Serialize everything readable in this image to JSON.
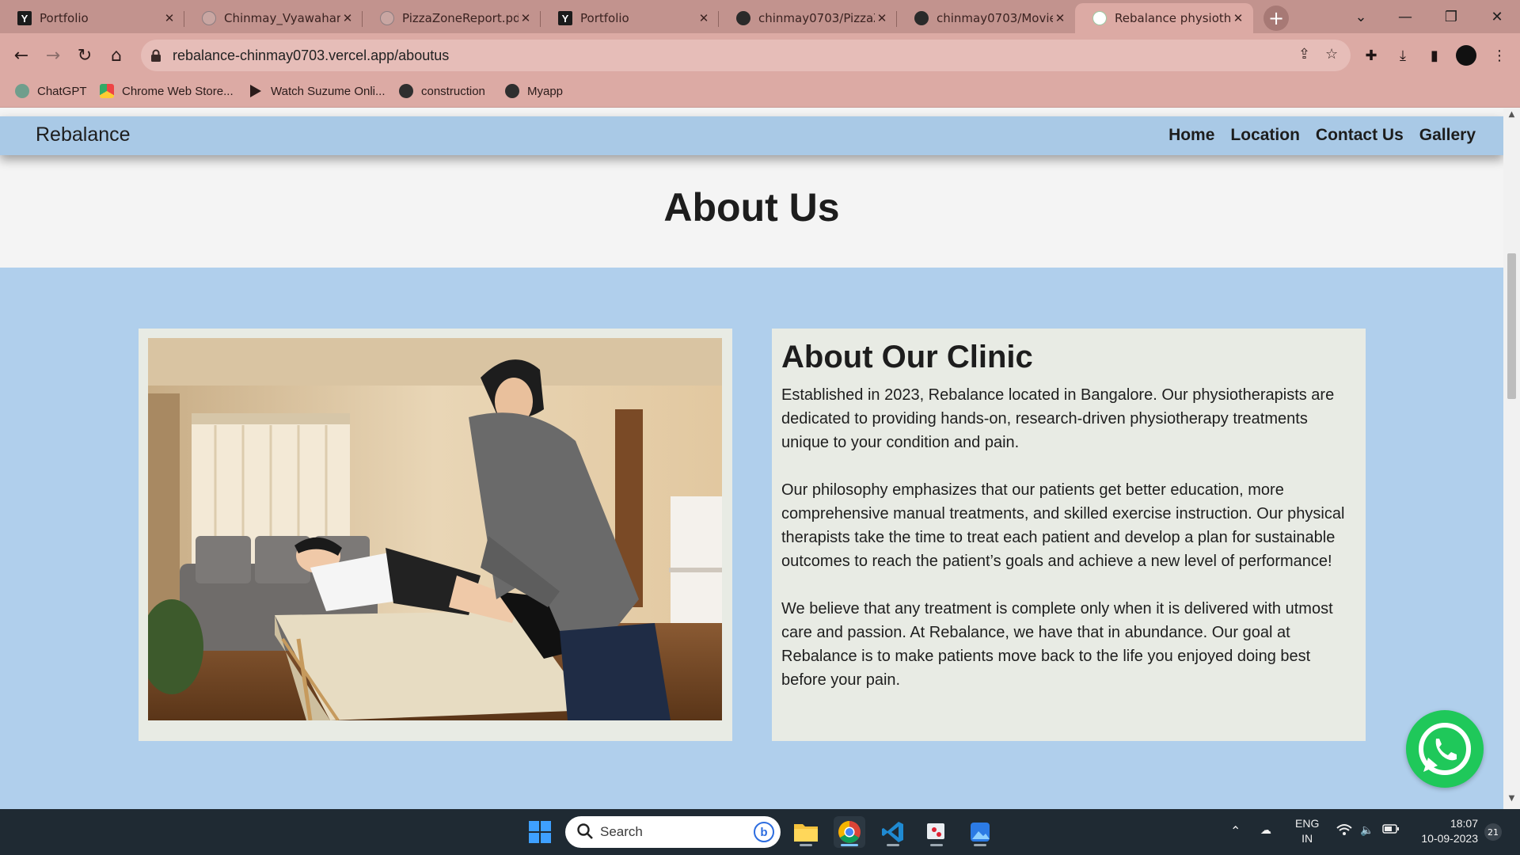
{
  "browser": {
    "tabs": [
      {
        "title": "Portfolio",
        "favicon": "y-icon"
      },
      {
        "title": "Chinmay_Vyawahare_",
        "favicon": "globe-icon"
      },
      {
        "title": "PizzaZoneReport.pdf",
        "favicon": "globe-icon"
      },
      {
        "title": "Portfolio",
        "favicon": "y-icon"
      },
      {
        "title": "chinmay0703/PizzaZo",
        "favicon": "github-icon"
      },
      {
        "title": "chinmay0703/MovieS",
        "favicon": "github-icon"
      },
      {
        "title": "Rebalance physiother",
        "favicon": "leaf-icon",
        "active": true
      }
    ],
    "url": "rebalance-chinmay0703.vercel.app/aboutus",
    "bookmarks": [
      {
        "label": "ChatGPT",
        "icon": "chatgpt-icon"
      },
      {
        "label": "Chrome Web Store...",
        "icon": "chrome-web-store-icon"
      },
      {
        "label": "Watch Suzume Onli...",
        "icon": "play-icon"
      },
      {
        "label": "construction",
        "icon": "globe-icon"
      },
      {
        "label": "Myapp",
        "icon": "globe-icon"
      }
    ],
    "chrome_color": "#dcaaa4"
  },
  "site": {
    "brand": "Rebalance",
    "nav": [
      "Home",
      "Location",
      "Contact Us",
      "Gallery"
    ],
    "heading": "About Us",
    "about": {
      "title": "About Our Clinic",
      "paragraphs": [
        "Established in 2023, Rebalance located in Bangalore. Our physiotherapists are dedicated to providing hands-on, research-driven physiotherapy treatments unique to your condition and pain.",
        "Our philosophy emphasizes that our patients get better education, more comprehensive manual treatments, and skilled exercise instruction. Our physical therapists take the time to treat each patient and develop a plan for sustainable outcomes to reach the patient’s goals and achieve a new level of performance!",
        "We believe that any treatment is complete only when it is delivered with utmost care and passion. At Rebalance, we have that in abundance. Our goal at Rebalance is to make patients move back to the life you enjoyed doing best before your pain."
      ]
    },
    "colors": {
      "navbar": "#a9c9e6",
      "band": "#b0cfec",
      "card": "#e8ebe4",
      "whatsapp": "#1fc85a"
    }
  },
  "taskbar": {
    "search_placeholder": "Search",
    "apps": [
      "windows-start-icon",
      "file-explorer-icon",
      "chrome-icon",
      "vscode-icon",
      "snipping-tool-icon",
      "photos-icon"
    ],
    "lang_line1": "ENG",
    "lang_line2": "IN",
    "time": "18:07",
    "date": "10-09-2023",
    "notification_count": "21"
  }
}
